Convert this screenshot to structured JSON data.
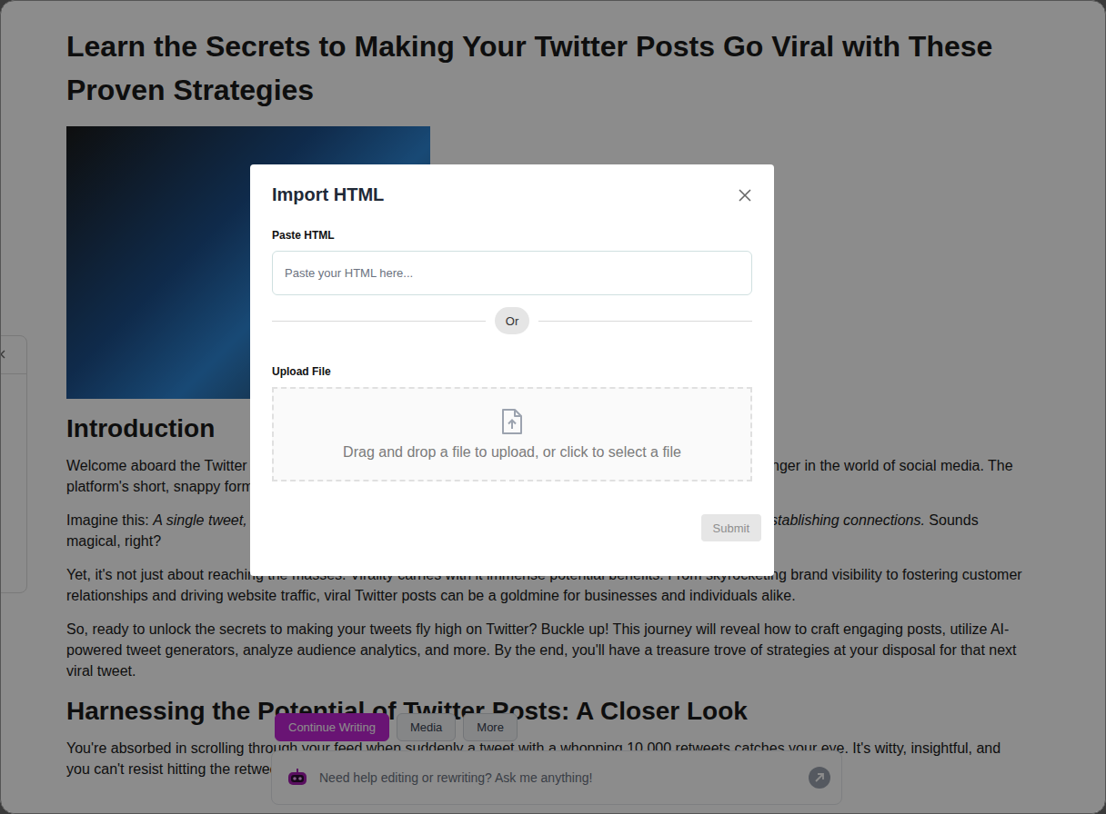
{
  "document": {
    "title": "Learn the Secrets to Making Your Twitter Posts Go Viral with These Proven Strategies",
    "blocks": [
      {
        "kind": "image"
      },
      {
        "kind": "heading",
        "text": "Introduction"
      },
      {
        "kind": "paragraph",
        "runs": [
          {
            "text": "Welcome aboard the Twitter express! In today's fast-paced digital landscape, Twitter has become a game-changer in the world of social media. The platform's short, snappy format gives everyone the power to influence and engage.",
            "italic": false
          }
        ]
      },
      {
        "kind": "paragraph",
        "runs": [
          {
            "text": "Imagine this: ",
            "italic": false
          },
          {
            "text": "A single tweet, crafted with care, sparks conversations across the globe, gaining followers and establishing connections.",
            "italic": true
          },
          {
            "text": " Sounds magical, right?",
            "italic": false
          }
        ]
      },
      {
        "kind": "paragraph",
        "runs": [
          {
            "text": "Yet, it's not just about reaching the masses. Virality carries with it immense potential benefits. From skyrocketing brand visibility to fostering customer relationships and driving website traffic, viral Twitter posts can be a goldmine for businesses and individuals alike.",
            "italic": false
          }
        ]
      },
      {
        "kind": "paragraph",
        "runs": [
          {
            "text": "So, ready to unlock the secrets to making your tweets fly high on Twitter? Buckle up! This journey will reveal how to craft engaging posts, utilize AI-powered tweet generators, analyze audience analytics, and more. By the end, you'll have a treasure trove of strategies at your disposal for that next viral tweet.",
            "italic": false
          }
        ]
      },
      {
        "kind": "heading",
        "text": "Harnessing the Potential of Twitter Posts: A Closer Look"
      },
      {
        "kind": "paragraph",
        "runs": [
          {
            "text": "You're absorbed in scrolling through your feed when suddenly a tweet with a whopping 10,000 retweets catches your eye. It's witty, insightful, and you can't resist hitting the retweet button. It's moments like this where a brand truly taps into the potential of Twitter.",
            "italic": false
          }
        ]
      }
    ]
  },
  "assistant": {
    "buttons": [
      {
        "label": "Continue Writing",
        "primary": true
      },
      {
        "label": "Media",
        "primary": false
      },
      {
        "label": "More",
        "primary": false
      }
    ],
    "placeholder": "Need help editing or rewriting? Ask me anything!"
  },
  "modal": {
    "title": "Import HTML",
    "paste_label": "Paste HTML",
    "paste_placeholder": "Paste your HTML here...",
    "divider": "Or",
    "upload_label": "Upload File",
    "upload_hint": "Drag and drop a file to upload, or click to select a file",
    "submit": {
      "label": "Submit",
      "disabled": true
    }
  }
}
